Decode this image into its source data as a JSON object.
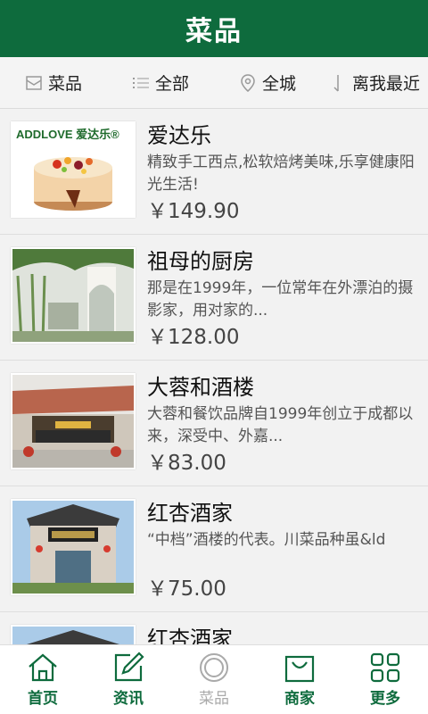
{
  "header": {
    "title": "菜品"
  },
  "filters": [
    {
      "label": "菜品",
      "icon": "box-icon"
    },
    {
      "label": "全部",
      "icon": "list-icon"
    },
    {
      "label": "全城",
      "icon": "location-pin-icon"
    },
    {
      "label": "离我最近",
      "icon": "sort-icon"
    }
  ],
  "items": [
    {
      "name": "爱达乐",
      "desc": "精致手工西点,松软焙烤美味,乐享健康阳光生活!",
      "price": "￥149.90",
      "logo_text": "ADDLOVE 爱达乐®"
    },
    {
      "name": "祖母的厨房",
      "desc": "那是在1999年，一位常年在外漂泊的摄影家，用对家的...",
      "price": "￥128.00"
    },
    {
      "name": "大蓉和酒楼",
      "desc": "大蓉和餐饮品牌自1999年创立于成都以来，深受中、外嘉...",
      "price": "￥83.00"
    },
    {
      "name": "红杏酒家",
      "desc": "“中档”酒楼的代表。川菜品种虽&ld",
      "price": "￥75.00"
    },
    {
      "name": "红杏酒家",
      "desc": "",
      "price": ""
    }
  ],
  "tabs": [
    {
      "label": "首页",
      "icon": "home-icon",
      "active": true
    },
    {
      "label": "资讯",
      "icon": "edit-icon",
      "active": true
    },
    {
      "label": "菜品",
      "icon": "circle-icon",
      "active": false
    },
    {
      "label": "商家",
      "icon": "shopping-bag-icon",
      "active": true
    },
    {
      "label": "更多",
      "icon": "grid-icon",
      "active": true
    }
  ],
  "colors": {
    "brand": "#0e6b3d",
    "inactive": "#aaaaaa"
  }
}
